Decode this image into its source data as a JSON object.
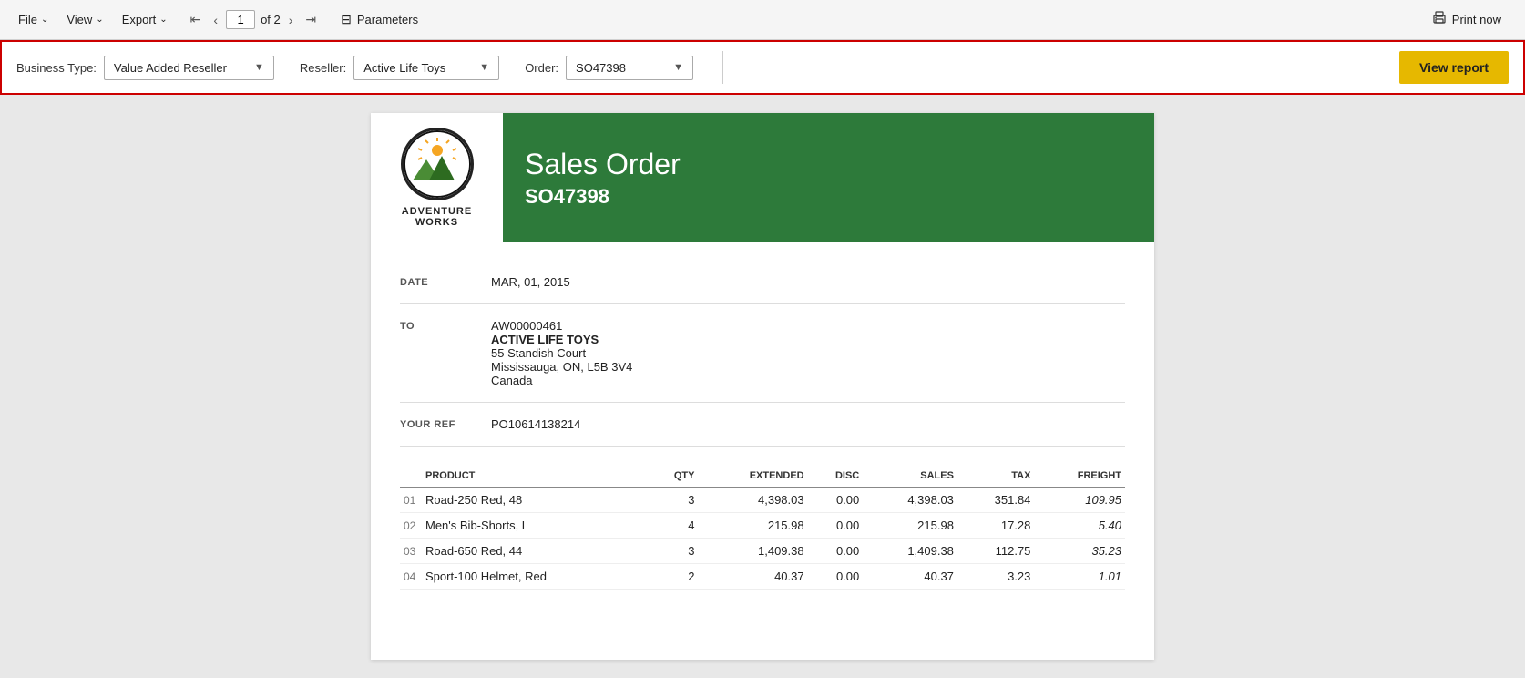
{
  "toolbar": {
    "file_label": "File",
    "view_label": "View",
    "export_label": "Export",
    "page_current": "1",
    "page_of": "of 2",
    "parameters_label": "Parameters",
    "print_label": "Print now"
  },
  "params_bar": {
    "business_type_label": "Business Type:",
    "business_type_value": "Value Added Reseller",
    "reseller_label": "Reseller:",
    "reseller_value": "Active Life Toys",
    "order_label": "Order:",
    "order_value": "SO47398",
    "view_report_label": "View report"
  },
  "report": {
    "title": "Sales Order",
    "order_number": "SO47398",
    "date_label": "DATE",
    "date_value": "MAR, 01, 2015",
    "to_label": "TO",
    "to_account": "AW00000461",
    "to_company": "ACTIVE LIFE TOYS",
    "to_address1": "55 Standish Court",
    "to_address2": "Mississauga, ON, L5B 3V4",
    "to_address3": "Canada",
    "your_ref_label": "YOUR REF",
    "your_ref_value": "PO10614138214",
    "table": {
      "columns": [
        "PRODUCT",
        "QTY",
        "EXTENDED",
        "DISC",
        "SALES",
        "TAX",
        "FREIGHT"
      ],
      "rows": [
        {
          "num": "01",
          "product": "Road-250 Red, 48",
          "qty": "3",
          "extended": "4,398.03",
          "disc": "0.00",
          "sales": "4,398.03",
          "tax": "351.84",
          "freight": "109.95"
        },
        {
          "num": "02",
          "product": "Men's Bib-Shorts, L",
          "qty": "4",
          "extended": "215.98",
          "disc": "0.00",
          "sales": "215.98",
          "tax": "17.28",
          "freight": "5.40"
        },
        {
          "num": "03",
          "product": "Road-650 Red, 44",
          "qty": "3",
          "extended": "1,409.38",
          "disc": "0.00",
          "sales": "1,409.38",
          "tax": "112.75",
          "freight": "35.23"
        },
        {
          "num": "04",
          "product": "Sport-100 Helmet, Red",
          "qty": "2",
          "extended": "40.37",
          "disc": "0.00",
          "sales": "40.37",
          "tax": "3.23",
          "freight": "1.01"
        }
      ]
    }
  },
  "logo": {
    "company_name": "Adventure\nWorks"
  }
}
